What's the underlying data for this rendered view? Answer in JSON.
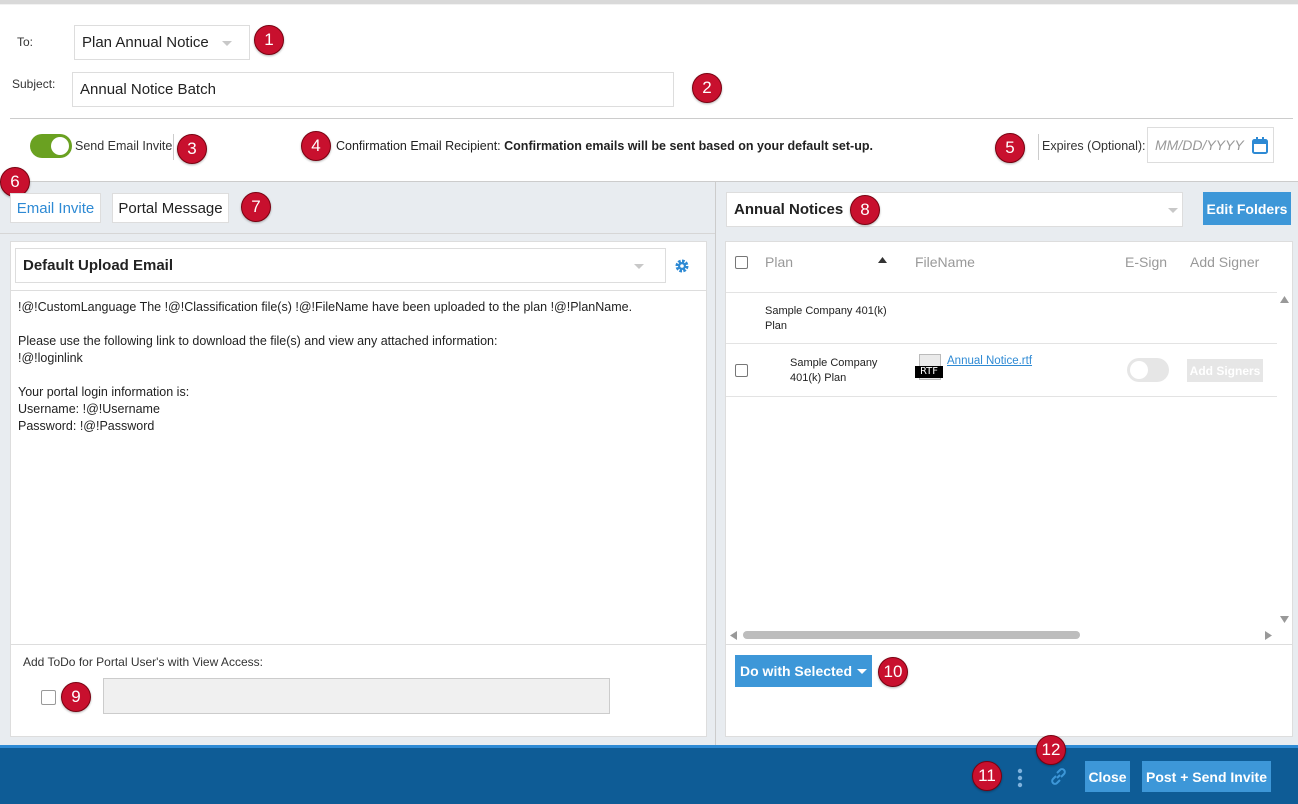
{
  "header": {
    "to_label": "To:",
    "to_value": "Plan Annual Notice",
    "subject_label": "Subject:",
    "subject_value": "Annual Notice Batch"
  },
  "options": {
    "send_email_invite_label": "Send Email Invite",
    "send_email_invite_on": true,
    "confirmation_label": "Confirmation Email Recipient:",
    "confirmation_value": "Confirmation emails will be sent based on your default set-up.",
    "expires_label": "Expires (Optional):",
    "expires_placeholder": "MM/DD/YYYY"
  },
  "left_panel": {
    "tabs": [
      "Email Invite",
      "Portal Message"
    ],
    "template_value": "Default Upload Email",
    "body_lines": [
      "!@!CustomLanguage The !@!Classification file(s) !@!FileName have been uploaded to the plan !@!PlanName.",
      "",
      "Please use the following link to download the file(s) and view any attached information:",
      "!@!loginlink",
      "",
      "Your portal login information is:",
      "Username: !@!Username",
      "Password: !@!Password"
    ],
    "todo_label": "Add ToDo for Portal User's with View Access:"
  },
  "right_panel": {
    "folder_value": "Annual Notices",
    "edit_folders_label": "Edit Folders",
    "columns": [
      "Plan",
      "FileName",
      "E-Sign",
      "Add Signer"
    ],
    "group_label": "Sample Company 401(k) Plan",
    "row": {
      "plan": "Sample Company 401(k) Plan",
      "file_icon_text": "RTF",
      "filename": "Annual Notice.rtf",
      "add_signers_label": "Add Signers"
    },
    "do_with_selected_label": "Do with Selected"
  },
  "footer": {
    "close_label": "Close",
    "post_label": "Post + Send Invite"
  },
  "badges": [
    "1",
    "2",
    "3",
    "4",
    "5",
    "6",
    "7",
    "8",
    "9",
    "10",
    "11",
    "12"
  ],
  "colors": {
    "accent": "#3d97d8",
    "toggle_on": "#6aa121",
    "footer_bg": "#0e5c96",
    "badge": "#c8102e"
  }
}
